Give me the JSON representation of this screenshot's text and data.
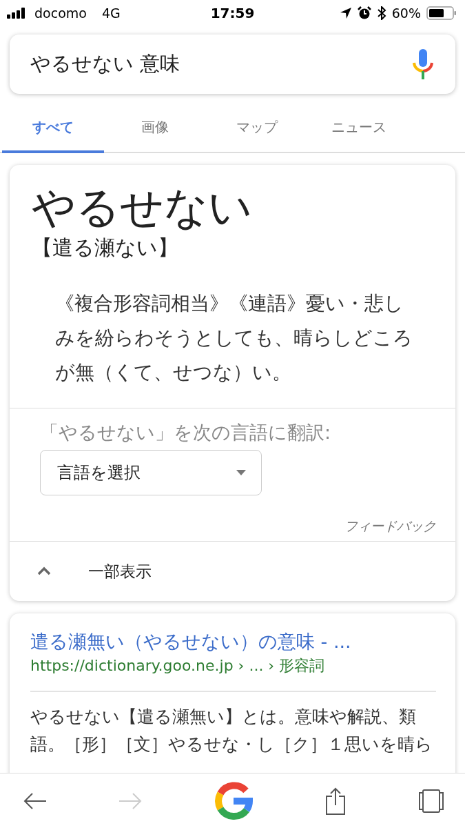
{
  "status_bar": {
    "carrier": "docomo",
    "network": "4G",
    "time": "17:59",
    "battery": "60%"
  },
  "search": {
    "value": "やるせない 意味"
  },
  "tabs": [
    {
      "label": "すべて",
      "selected": true
    },
    {
      "label": "画像",
      "selected": false
    },
    {
      "label": "マップ",
      "selected": false
    },
    {
      "label": "ニュース",
      "selected": false
    }
  ],
  "dictionary_card": {
    "word": "やるせない",
    "kanji": "【遣る瀬ない】",
    "definition": "《複合形容詞相当》《連語》憂い・悲しみを紛らわそうとしても、晴らしどころが無（くて、せつな）い。",
    "translate_label": "「やるせない」を次の言語に翻訳:",
    "language_select": "言語を選択",
    "feedback": "フィードバック",
    "collapse": {
      "label": "一部表示",
      "expanded": true
    }
  },
  "result": {
    "title": "遣る瀬無い（やるせない）の意味 - ...",
    "url": "https://dictionary.goo.ne.jp › ... › 形容詞",
    "snippet": "やるせない【遣る瀬無い】とは。意味や解説、類語。［形］［文］やるせな・し［ク］１思いを晴ら"
  },
  "toolbar": {
    "forward_disabled": true
  }
}
